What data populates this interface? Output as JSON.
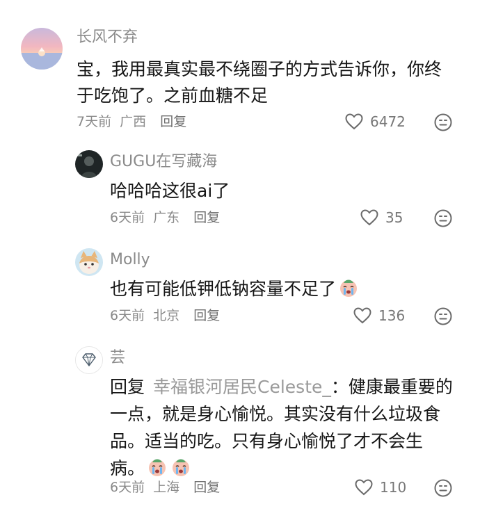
{
  "comments": [
    {
      "username": "长风不弃",
      "text": "宝，我用最真实最不绕圈子的方式告诉你，你终于吃饱了。之前血糖不足",
      "time": "7天前",
      "location": "广西",
      "reply_label": "回复",
      "likes": "6472",
      "avatar_icon": "sunset-sea-avatar"
    },
    {
      "username": "GUGU在写藏海",
      "text": "哈哈哈这很ai了",
      "time": "6天前",
      "location": "广东",
      "reply_label": "回复",
      "likes": "35",
      "avatar_icon": "dark-photo-avatar"
    },
    {
      "username": "Molly",
      "text": "也有可能低钾低钠容量不足了",
      "time": "6天前",
      "location": "北京",
      "reply_label": "回复",
      "likes": "136",
      "avatar_icon": "cat-avatar",
      "emoji": "crying-face-emoji"
    },
    {
      "username": "芸",
      "reply_prefix": "回复",
      "reply_to": "幸福银河居民Celeste_",
      "reply_colon": "：",
      "text": "健康最重要的一点，就是身心愉悦。其实没有什么垃圾食品。适当的吃。只有身心愉悦了才不会生病。",
      "time": "6天前",
      "location": "上海",
      "reply_label": "回复",
      "likes": "110",
      "avatar_icon": "diamond-avatar",
      "emoji": "crying-face-emoji"
    }
  ],
  "icons": {
    "like": "heart-outline-icon",
    "dislike": "neutral-face-icon"
  },
  "colors": {
    "text": "#161616",
    "secondary": "#8a8a8a",
    "background": "#ffffff"
  }
}
